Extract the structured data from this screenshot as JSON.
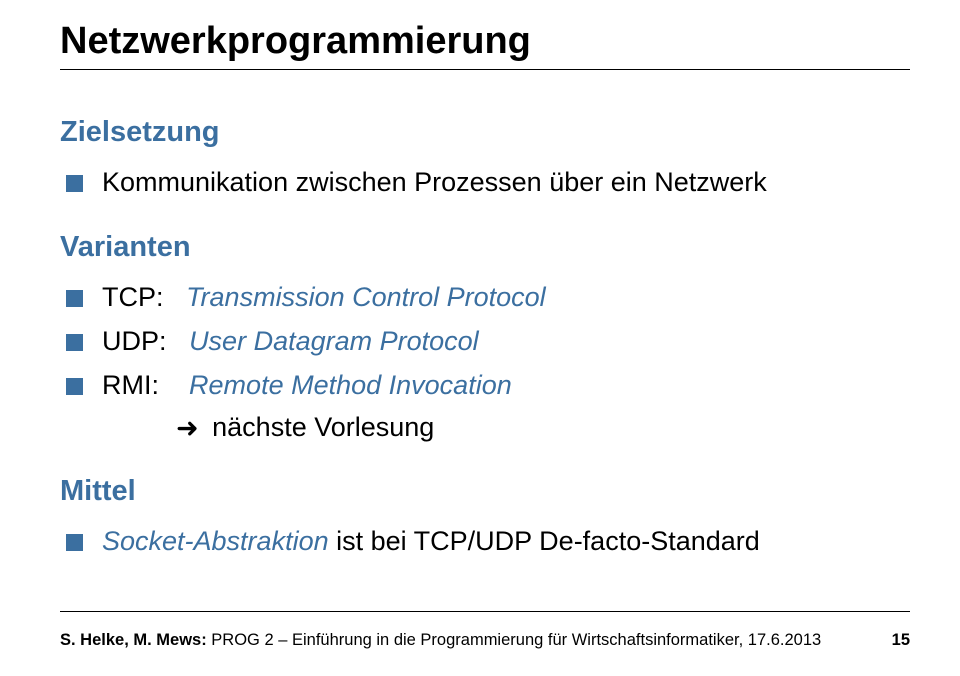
{
  "title": "Netzwerkprogrammierung",
  "sections": {
    "ziel": {
      "heading": "Zielsetzung",
      "items": [
        {
          "text": "Kommunikation zwischen Prozessen über ein Netzwerk"
        }
      ]
    },
    "varianten": {
      "heading": "Varianten",
      "items": [
        {
          "label": "TCP:",
          "name": "Transmission Control Protocol"
        },
        {
          "label": "UDP:",
          "name": "User Datagram Protocol"
        },
        {
          "label": "RMI:",
          "name": "Remote Method Invocation",
          "sub_arrow": "➜",
          "sub_text": "nächste Vorlesung"
        }
      ]
    },
    "mittel": {
      "heading": "Mittel",
      "items": [
        {
          "name": "Socket-Abstraktion",
          "rest": " ist bei TCP/UDP De-facto-Standard"
        }
      ]
    }
  },
  "footer": {
    "authors": "S. Helke, M. Mews:",
    "course": " PROG 2 – Einführung in die Programmierung für Wirtschaftsinformatiker, 17.6.2013",
    "page": "15"
  }
}
